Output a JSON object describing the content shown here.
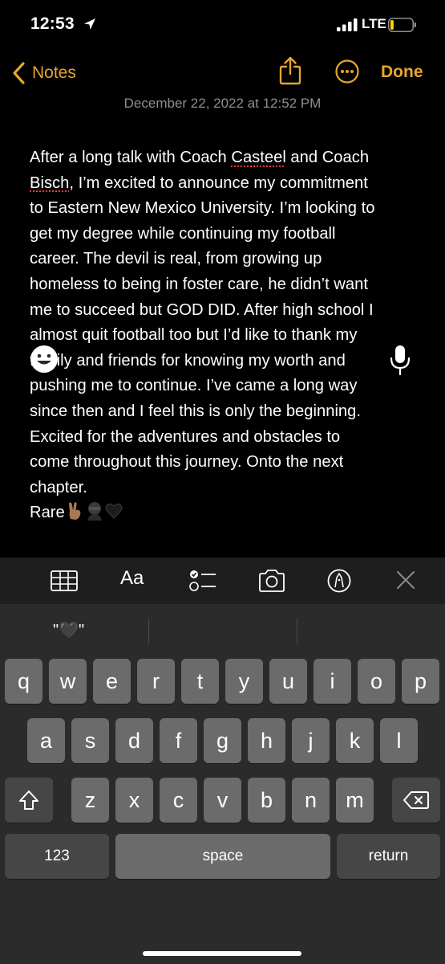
{
  "status_bar": {
    "time": "12:53",
    "network": "LTE",
    "battery_level": 0.15,
    "battery_color": "#ffd60a"
  },
  "nav": {
    "back_label": "Notes",
    "done_label": "Done",
    "accent_color": "#e5a72c",
    "icons": [
      "chevron-left-icon",
      "share-icon",
      "more-circle-icon"
    ]
  },
  "note": {
    "date": "December 22, 2022 at 12:52 PM",
    "lines": [
      "After a long talk with Coach ",
      "Casteel",
      " and Coach",
      "Bisch",
      ", I’m excited to announce my commitment",
      "to Eastern New Mexico University. I’m looking to",
      "get my degree while continuing my football",
      "career. The devil is real, from growing up",
      "homeless to being in foster care, he didn’t want",
      "me to succeed but GOD DID. After high school I",
      "almost quit football too but I’d like to thank my",
      "family and friends for knowing my worth and",
      "pushing me to continue. I’ve came a long way",
      "since then and I feel this is only the beginning.",
      "Excited for the adventures and obstacles to",
      "come throughout this journey. Onto the next",
      "chapter.",
      "Rare"
    ],
    "emojis": [
      "✌🏽",
      "🥷🏿",
      "🖤"
    ]
  },
  "toolbar": {
    "format_label": "Aa",
    "icons": [
      "table-icon",
      "checklist-icon",
      "camera-icon",
      "markup-pen-icon",
      "close-icon"
    ]
  },
  "keyboard": {
    "prediction": "\"🖤\"",
    "row1": [
      "q",
      "w",
      "e",
      "r",
      "t",
      "y",
      "u",
      "i",
      "o",
      "p"
    ],
    "row2": [
      "a",
      "s",
      "d",
      "f",
      "g",
      "h",
      "j",
      "k",
      "l"
    ],
    "row3": [
      "z",
      "x",
      "c",
      "v",
      "b",
      "n",
      "m"
    ],
    "numbers_label": "123",
    "space_label": "space",
    "return_label": "return",
    "icons": [
      "shift-icon",
      "backspace-icon",
      "emoji-icon",
      "microphone-icon"
    ]
  }
}
